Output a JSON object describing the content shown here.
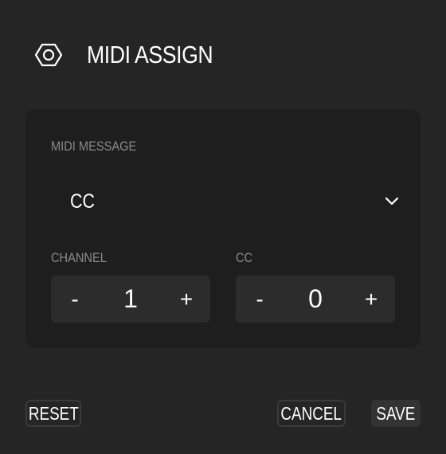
{
  "header": {
    "icon": "hexagon-nut-icon",
    "title": "MIDI ASSIGN"
  },
  "message": {
    "label": "MIDI MESSAGE",
    "selected": "CC",
    "chevron_icon": "chevron-down-icon"
  },
  "channel": {
    "label": "CHANNEL",
    "decrement": "-",
    "value": "1",
    "increment": "+"
  },
  "cc": {
    "label": "CC",
    "decrement": "-",
    "value": "0",
    "increment": "+"
  },
  "footer": {
    "reset_label": "RESET",
    "cancel_label": "CANCEL",
    "save_label": "SAVE"
  },
  "colors": {
    "background": "#252525",
    "panel": "#1e1e1e",
    "stepper": "#2c2c2c",
    "label": "#8a8a8a",
    "text": "#ffffff"
  }
}
